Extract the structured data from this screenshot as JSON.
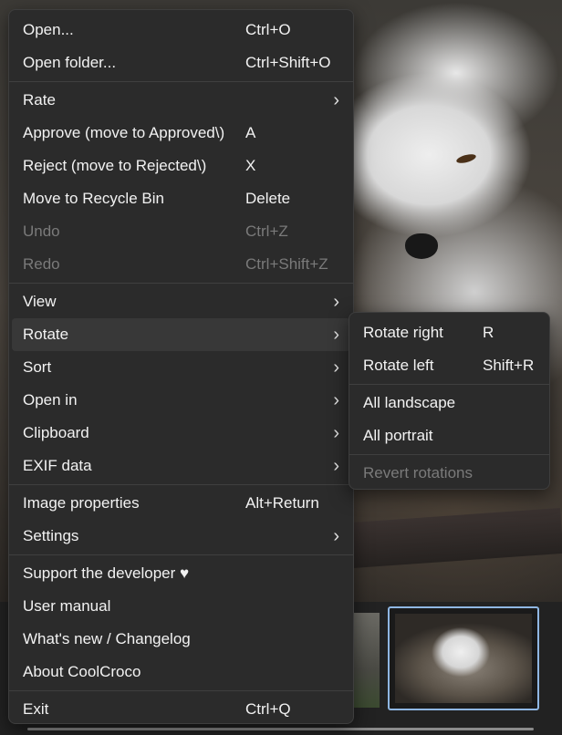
{
  "menu": {
    "groups": [
      [
        {
          "label": "Open...",
          "shortcut": "Ctrl+O"
        },
        {
          "label": "Open folder...",
          "shortcut": "Ctrl+Shift+O"
        }
      ],
      [
        {
          "label": "Rate",
          "shortcut": ""
        },
        {
          "label": "Approve (move to Approved\\)",
          "shortcut": "A"
        },
        {
          "label": "Reject (move to Rejected\\)",
          "shortcut": "X"
        },
        {
          "label": "Move to Recycle Bin",
          "shortcut": "Delete"
        },
        {
          "label": "Undo",
          "shortcut": "Ctrl+Z"
        },
        {
          "label": "Redo",
          "shortcut": "Ctrl+Shift+Z"
        }
      ],
      [
        {
          "label": "View",
          "shortcut": ""
        },
        {
          "label": "Rotate",
          "shortcut": ""
        },
        {
          "label": "Sort",
          "shortcut": ""
        },
        {
          "label": "Open in",
          "shortcut": ""
        },
        {
          "label": "Clipboard",
          "shortcut": ""
        },
        {
          "label": "EXIF data",
          "shortcut": ""
        }
      ],
      [
        {
          "label": "Image properties",
          "shortcut": "Alt+Return"
        },
        {
          "label": "Settings",
          "shortcut": ""
        }
      ],
      [
        {
          "label": "Support the developer ♥",
          "shortcut": ""
        },
        {
          "label": "User manual",
          "shortcut": ""
        },
        {
          "label": "What's new / Changelog",
          "shortcut": ""
        },
        {
          "label": "About CoolCroco",
          "shortcut": ""
        }
      ],
      [
        {
          "label": "Exit",
          "shortcut": "Ctrl+Q"
        }
      ]
    ]
  },
  "rotate_submenu": {
    "groups": [
      [
        {
          "label": "Rotate right",
          "shortcut": "R"
        },
        {
          "label": "Rotate left",
          "shortcut": "Shift+R"
        }
      ],
      [
        {
          "label": "All landscape",
          "shortcut": ""
        },
        {
          "label": "All portrait",
          "shortcut": ""
        }
      ],
      [
        {
          "label": "Revert rotations",
          "shortcut": ""
        }
      ]
    ]
  },
  "icons": {
    "submenu_arrow": "chevron-right-icon"
  },
  "colors": {
    "menu_bg": "#2b2b2b",
    "highlight": "#383838",
    "thumbnail_border": "#8fb7e3",
    "disabled_text": "#7a7a7a"
  }
}
